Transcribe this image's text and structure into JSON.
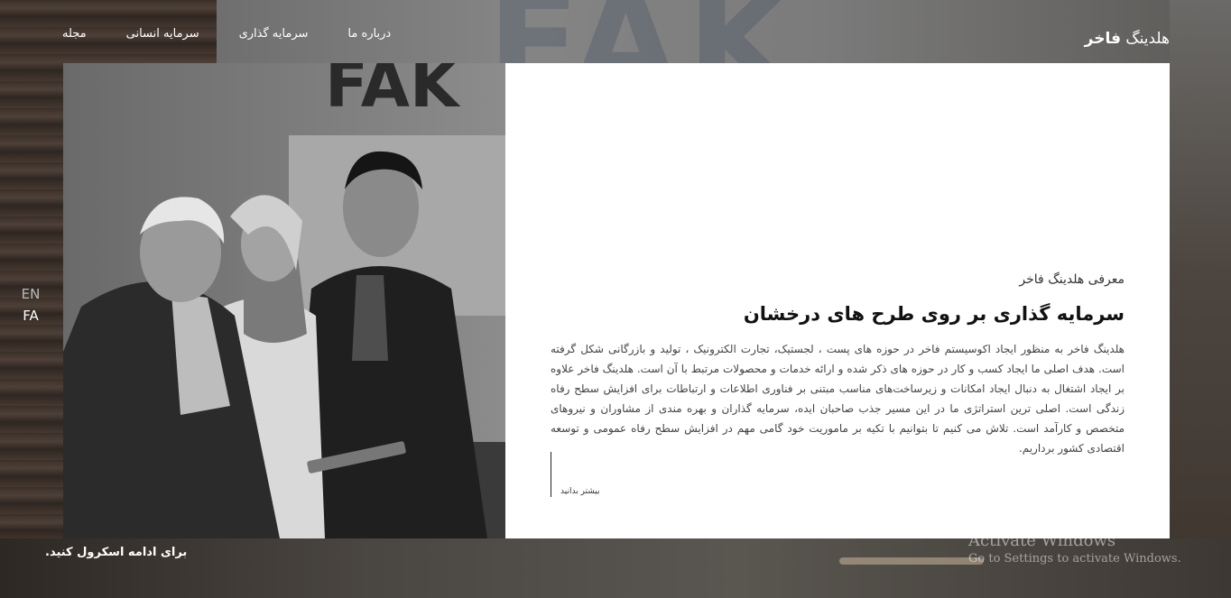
{
  "header": {
    "brand_prefix": "هلدینگ",
    "brand_name": "فاخر",
    "nav": [
      {
        "label": "مجله"
      },
      {
        "label": "سرمایه انسانی"
      },
      {
        "label": "سرمایه گذاری"
      },
      {
        "label": "درباره ما"
      }
    ]
  },
  "languages": {
    "en": "EN",
    "fa": "FA"
  },
  "hero": {
    "eyebrow": "معرفی هلدینگ فاخر",
    "title": "سرمایه گذاری بر روی طرح های درخشان",
    "description": "هلدینگ فاخر به منظور ایجاد اکوسیستم فاخر در حوزه های پست ، لجستیک، تجارت الکترونیک ، تولید و بازرگانی شکل گرفته است. هدف اصلی ما ایجاد کسب و کار در حوزه های ذکر شده و ارائه خدمات و محصولات مرتبط با آن است. هلدینگ فاخر علاوه بر ایجاد اشتغال به دنبال ایجاد امکانات و زیرساخت‌های مناسب مبتنی بر فناوری اطلاعات و ارتباطات برای افزایش سطح رفاه زندگی است. اصلی ترین استراتژی ما در این مسیر جذب صاحبان ایده، سرمایه گذاران و بهره مندی از مشاوران و نیروهای متخصص و کارآمد است. تلاش می کنیم تا بتوانیم با تکیه بر ماموریت خود گامی مهم در افزایش سطح رفاه عمومی و توسعه اقتصادی کشور برداریم.",
    "more_label": "بیشتر بدانید",
    "photo_sign_text": "FAK"
  },
  "footer": {
    "scroll_hint": "برای ادامه اسکرول کنید."
  },
  "windows_watermark": {
    "line1": "Activate Windows",
    "line2": "Go to Settings to activate Windows."
  },
  "colors": {
    "card_bg": "#ffffff",
    "text_dark": "#111111",
    "text_body": "#444444",
    "nav_text": "#ffffff"
  }
}
